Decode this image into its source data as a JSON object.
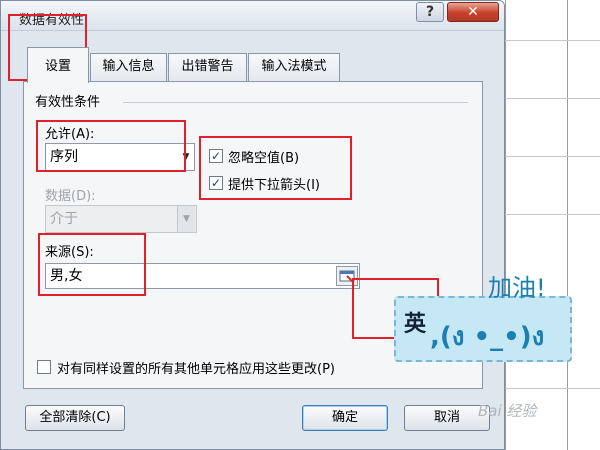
{
  "dialog": {
    "title": "数据有效性",
    "help_label": "?",
    "close_label": "✕"
  },
  "tabs": [
    {
      "label": "设置",
      "active": true
    },
    {
      "label": "输入信息",
      "active": false
    },
    {
      "label": "出错警告",
      "active": false
    },
    {
      "label": "输入法模式",
      "active": false
    }
  ],
  "validation": {
    "group_label": "有效性条件",
    "allow_label": "允许(A):",
    "allow_value": "序列",
    "ignore_blank_label": "忽略空值(B)",
    "ignore_blank_checked": true,
    "dropdown_label": "提供下拉箭头(I)",
    "dropdown_checked": true,
    "data_label": "数据(D):",
    "data_value": "介于",
    "source_label": "来源(S):",
    "source_value": "男,女",
    "apply_all_label": "对有同样设置的所有其他单元格应用这些更改(P)",
    "apply_all_checked": false
  },
  "buttons": {
    "clear_all": "全部清除(C)",
    "ok": "确定",
    "cancel": "取消"
  },
  "overlay": {
    "sticker_top": "加油!",
    "sticker_face": ",(ง •_•)ง",
    "sticker_char": "英",
    "watermark": "Bai 经验"
  },
  "colors": {
    "annotation_red": "#e0202a",
    "sticker_blue": "#1a7fb5"
  }
}
